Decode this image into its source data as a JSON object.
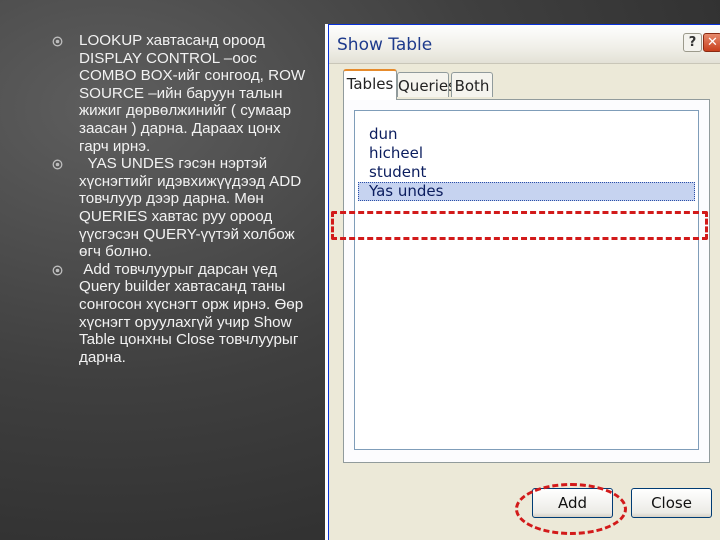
{
  "slide": {
    "bullets": [
      {
        "icon": "circle-bullet-icon",
        "text": "LOOKUP хавтасанд ороод DISPLAY CONTROL –оос COMBO BOX-ийг сонгоод, ROW SOURCE –ийн баруун талын жижиг дөрвөлжинийг ( сумаар заасан ) дарна. Дараах цонх гарч ирнэ."
      },
      {
        "icon": "circle-bullet-icon",
        "text": "  YAS UNDES гэсэн нэртэй хүснэгтийг идэвхижүүдээд ADD товчлуур дээр дарна. Мөн QUERIES хавтас руу ороод үүсгэсэн QUERY-үүтэй холбож өгч болно."
      },
      {
        "icon": "circle-bullet-icon",
        "text": " Add товчлуурыг дарсан үед Query builder хавтасанд таны сонгосон хүснэгт орж ирнэ. Өөр хүснэгт оруулахгүй учир Show Table цонхны Close товчлуурыг дарна."
      }
    ]
  },
  "dialog": {
    "title": "Show Table",
    "help_label": "?",
    "close_label": "✕",
    "tabs": [
      "Tables",
      "Queries",
      "Both"
    ],
    "active_tab": "Tables",
    "list_items": [
      "dun",
      "hicheel",
      "student",
      "Yas undes"
    ],
    "selected_item": "Yas undes",
    "buttons": {
      "add": "Add",
      "close": "Close"
    }
  },
  "colors": {
    "annotation": "#d21a1a",
    "selection": "#c6d3f0",
    "active_tab_accent": "#e68b2c"
  }
}
